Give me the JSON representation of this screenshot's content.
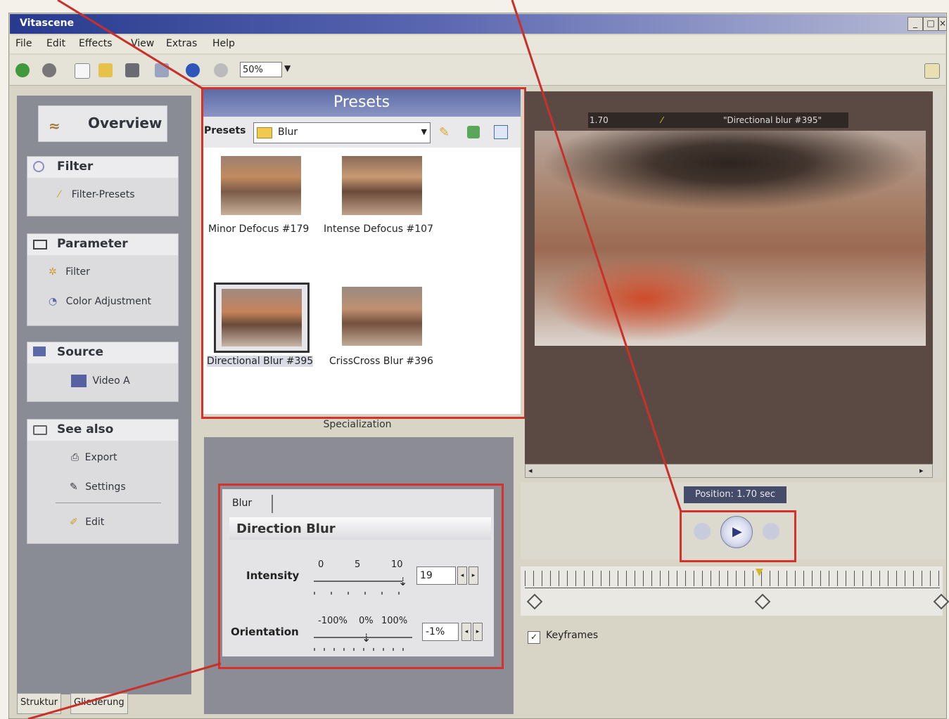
{
  "window": {
    "title": "Vitascene",
    "controls": [
      "_",
      "□",
      "×"
    ]
  },
  "menu": [
    "File",
    "Edit",
    "Effects",
    "View",
    "Extras",
    "Help"
  ],
  "toolbar": {
    "zoom_value": "50%"
  },
  "sidebar": {
    "overview_label": "Overview",
    "sections": [
      {
        "title": "Filter",
        "items": [
          "Filter-Presets"
        ]
      },
      {
        "title": "Parameter",
        "items": [
          "Filter",
          "Color Adjustment"
        ]
      },
      {
        "title": "Source",
        "items": [
          "Video A"
        ]
      },
      {
        "title": "See also",
        "items": [
          "Export",
          "Settings",
          "Edit"
        ]
      }
    ],
    "bottom_tabs": [
      "Struktur",
      "Gliederung"
    ]
  },
  "presets": {
    "header": "Presets",
    "bar_label": "Presets",
    "folder_value": "Blur",
    "items": [
      {
        "label": "Minor Defocus #179",
        "selected": false
      },
      {
        "label": "Intense Defocus #107",
        "selected": false
      },
      {
        "label": "Directional Blur #395",
        "selected": true
      },
      {
        "label": "CrissCross Blur #396",
        "selected": false
      }
    ]
  },
  "specialization": {
    "label": "Specialization",
    "tab": "Blur",
    "title": "Direction Blur",
    "intensity": {
      "label": "Intensity",
      "ticks": [
        "0",
        "5",
        "10"
      ],
      "value": "19"
    },
    "orientation": {
      "label": "Orientation",
      "ticks": [
        "-100%",
        "0%",
        "100%"
      ],
      "value": "-1%"
    }
  },
  "preview": {
    "time": "1.70",
    "preset_name": "\"Directional blur #395\"",
    "position_label": "Position: 1.70 sec"
  },
  "timeline": {
    "keyframes_label": "Keyframes",
    "keyframes_checked": true
  }
}
